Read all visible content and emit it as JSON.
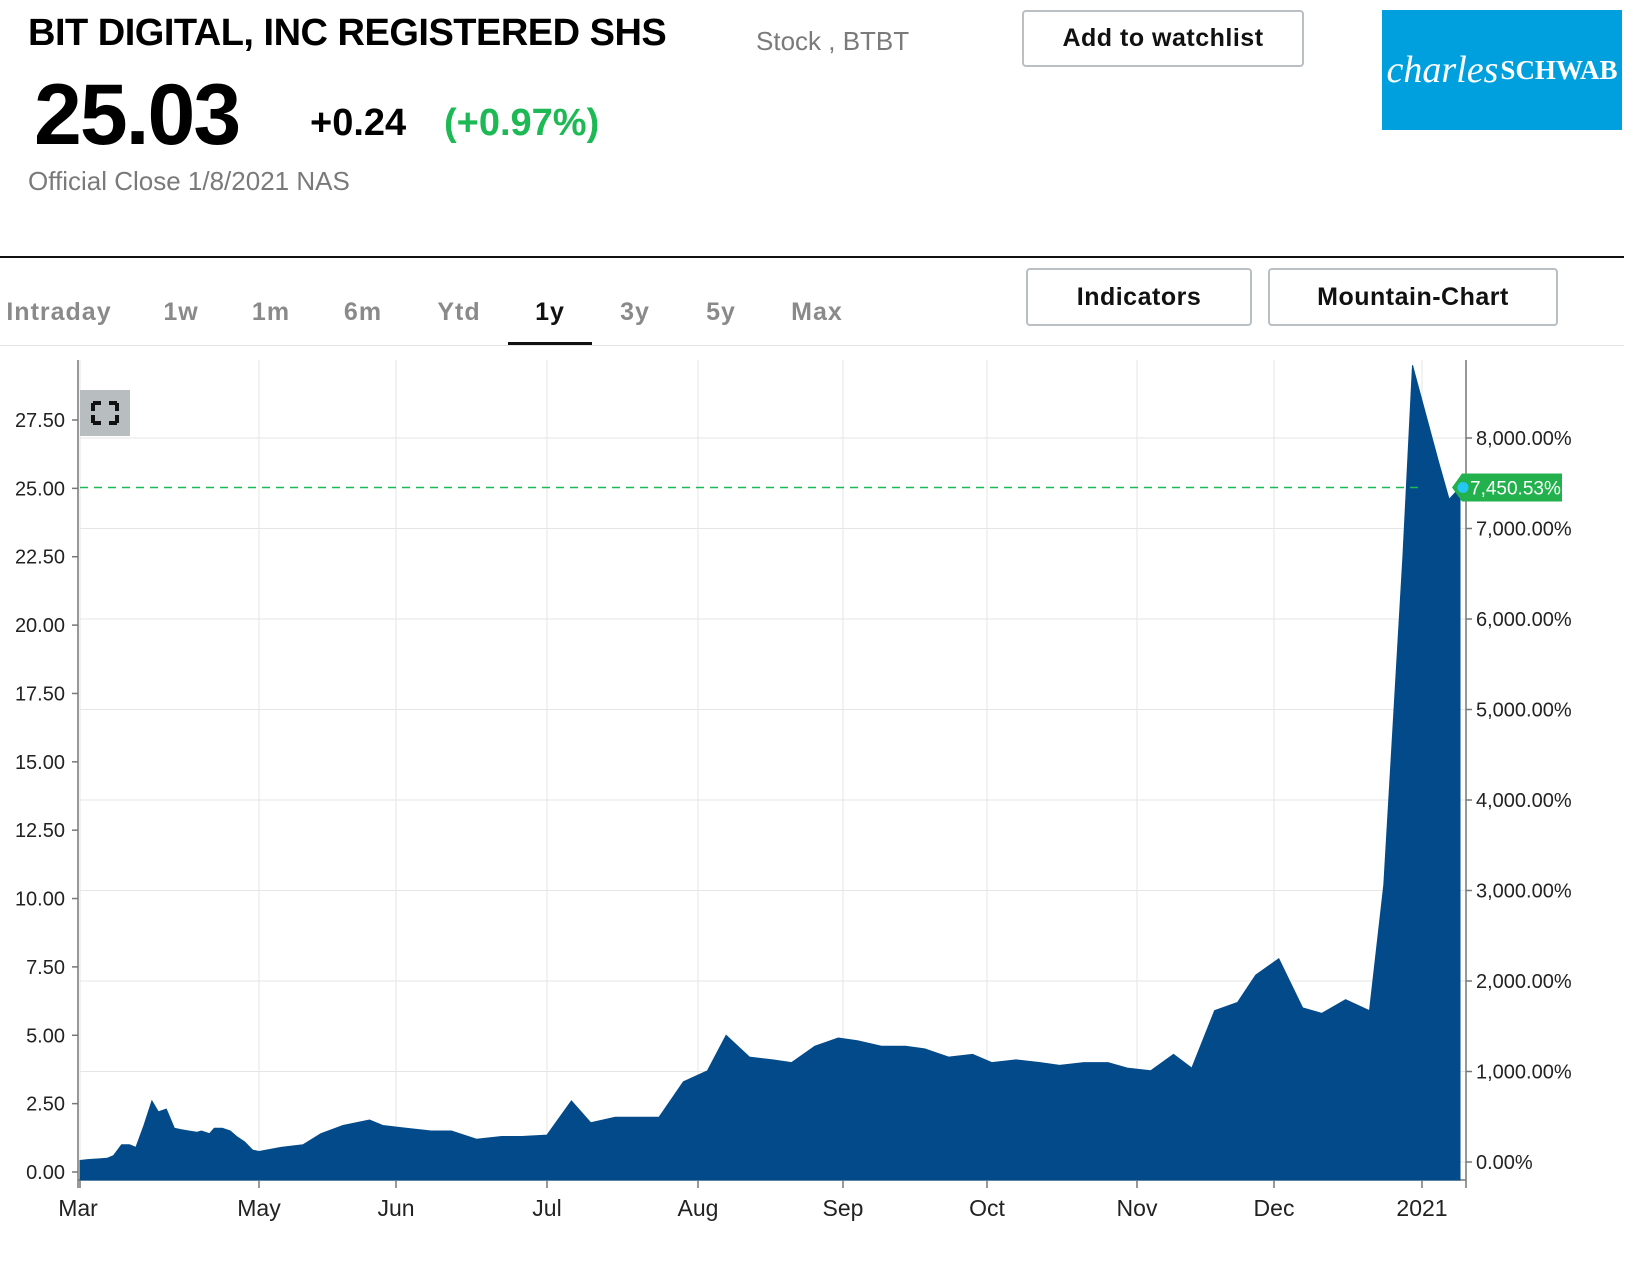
{
  "header": {
    "title": "BIT DIGITAL, INC REGISTERED SHS",
    "subtitle": "Stock , BTBT",
    "price": "25.03",
    "change": "+0.24",
    "change_pct": "(+0.97%)",
    "official_close": "Official Close 1/8/2021 NAS",
    "watchlist_label": "Add to watchlist",
    "logo_part1": "charles",
    "logo_part2": "SCHWAB"
  },
  "tabs": [
    {
      "label": "Intraday",
      "active": false
    },
    {
      "label": "1w",
      "active": false
    },
    {
      "label": "1m",
      "active": false
    },
    {
      "label": "6m",
      "active": false
    },
    {
      "label": "Ytd",
      "active": false
    },
    {
      "label": "1y",
      "active": true
    },
    {
      "label": "3y",
      "active": false
    },
    {
      "label": "5y",
      "active": false
    },
    {
      "label": "Max",
      "active": false
    }
  ],
  "buttons": {
    "indicators": "Indicators",
    "chart_type": "Mountain-Chart"
  },
  "colors": {
    "area": "#034a8a",
    "positive": "#1db954",
    "logo_bg": "#00a0df"
  },
  "icons": {
    "expand": "expand-icon"
  },
  "chart_data": {
    "type": "area",
    "title": "",
    "xlabel": "",
    "ylabel": "",
    "x_ticks": [
      "Mar",
      "May",
      "Jun",
      "Jul",
      "Aug",
      "Sep",
      "Oct",
      "Nov",
      "Dec",
      "2021"
    ],
    "ylim": [
      0,
      30
    ],
    "y_ticks": [
      0,
      2.5,
      5,
      7.5,
      10,
      12.5,
      15,
      17.5,
      20,
      22.5,
      25,
      27.5
    ],
    "y_tick_labels": [
      "0.00",
      "2.50",
      "5.00",
      "7.50",
      "10.00",
      "12.50",
      "15.00",
      "17.50",
      "20.00",
      "22.50",
      "25.00",
      "27.50"
    ],
    "y2_ticks": [
      "0.00%",
      "1,000.00%",
      "2,000.00%",
      "3,000.00%",
      "4,000.00%",
      "5,000.00%",
      "6,000.00%",
      "7,000.00%",
      "8,000.00%"
    ],
    "y2_values": [
      0,
      1000,
      2000,
      3000,
      4000,
      5000,
      6000,
      7000,
      8000
    ],
    "last_price": 25.03,
    "last_label": "7,450.53%",
    "grid": true,
    "series": [
      {
        "x": [
          "2020-01-10",
          "2020-01-14",
          "2020-01-17",
          "2020-01-22",
          "2020-01-27",
          "2020-01-31",
          "2020-02-05",
          "2020-02-10",
          "2020-02-14",
          "2020-02-19",
          "2020-02-24",
          "2020-02-28",
          "2020-03-04",
          "2020-03-09",
          "2020-03-13",
          "2020-03-18",
          "2020-03-23",
          "2020-03-26",
          "2020-03-31",
          "2020-04-03",
          "2020-04-08",
          "2020-04-13",
          "2020-04-17",
          "2020-04-22",
          "2020-04-27",
          "2020-05-01",
          "2020-05-06",
          "2020-05-11",
          "2020-05-15",
          "2020-05-20",
          "2020-05-26",
          "2020-05-29",
          "2020-06-03",
          "2020-06-08",
          "2020-06-12",
          "2020-06-17",
          "2020-06-22",
          "2020-06-26",
          "2020-07-01",
          "2020-07-06",
          "2020-07-10",
          "2020-07-15",
          "2020-07-20",
          "2020-07-24",
          "2020-07-29",
          "2020-08-03",
          "2020-08-07",
          "2020-08-12",
          "2020-08-17",
          "2020-08-21",
          "2020-08-26",
          "2020-08-31",
          "2020-09-04",
          "2020-09-09",
          "2020-09-14",
          "2020-09-18",
          "2020-09-23",
          "2020-09-28",
          "2020-10-02",
          "2020-10-07",
          "2020-10-12",
          "2020-10-16",
          "2020-10-21",
          "2020-10-26",
          "2020-10-30",
          "2020-11-04",
          "2020-11-09",
          "2020-11-13",
          "2020-11-18",
          "2020-11-23",
          "2020-11-27",
          "2020-12-02",
          "2020-12-07",
          "2020-12-11",
          "2020-12-16",
          "2020-12-21",
          "2020-12-24",
          "2020-12-28",
          "2020-12-30",
          "2021-01-04",
          "2021-01-06",
          "2021-01-08"
        ],
        "y": [
          0.42,
          0.45,
          0.46,
          0.48,
          0.5,
          0.6,
          1.0,
          1.0,
          0.9,
          1.7,
          2.6,
          2.2,
          2.3,
          1.6,
          1.55,
          1.5,
          1.45,
          1.5,
          1.4,
          1.6,
          1.6,
          1.5,
          1.3,
          1.1,
          0.8,
          0.75,
          0.9,
          1.0,
          1.4,
          1.7,
          1.9,
          1.7,
          1.6,
          1.5,
          1.5,
          1.2,
          1.3,
          1.3,
          1.35,
          2.6,
          1.8,
          2.0,
          2.0,
          2.0,
          3.3,
          3.7,
          5.0,
          4.2,
          4.1,
          4.0,
          4.6,
          4.9,
          4.8,
          4.6,
          4.6,
          4.5,
          4.2,
          4.3,
          4.0,
          4.1,
          4.0,
          3.9,
          4.0,
          4.0,
          3.8,
          3.7,
          4.3,
          3.8,
          5.9,
          6.2,
          7.2,
          7.8,
          6.0,
          5.8,
          6.3,
          5.9,
          10.5,
          22.5,
          29.5,
          26.0,
          24.6,
          25.03
        ]
      }
    ]
  }
}
